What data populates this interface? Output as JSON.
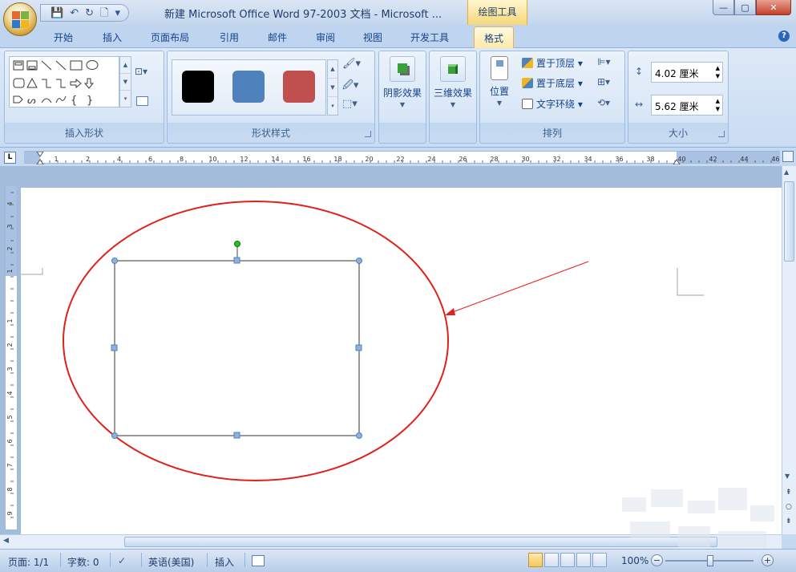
{
  "titlebar": {
    "title": "新建 Microsoft Office Word 97-2003 文档 - Microsoft ...",
    "context_tab": "绘图工具",
    "qat_save": "💾",
    "qat_undo": "↶",
    "qat_redo": "↻",
    "qat_preview": "🗋",
    "qat_more": "▾",
    "minimize": "—",
    "maximize": "▢",
    "close": "✕"
  },
  "tabs": [
    "开始",
    "插入",
    "页面布局",
    "引用",
    "邮件",
    "审阅",
    "视图",
    "开发工具",
    "格式"
  ],
  "active_tab": "格式",
  "ribbon": {
    "insert_shapes": {
      "label": "插入形状",
      "edit_shape": "⊡▾"
    },
    "shape_styles": {
      "label": "形状样式",
      "swatches": [
        "#000000",
        "#4f81bd",
        "#c0504d"
      ],
      "fill": "🖌▾",
      "outline": "🖉▾",
      "change": "⬚▾"
    },
    "shadow": {
      "label": "阴影效果"
    },
    "three_d": {
      "label": "三维效果"
    },
    "arrange": {
      "label": "排列",
      "position": "位置",
      "bring_front": "置于顶层 ▾",
      "send_back": "置于底层 ▾",
      "text_wrap": "文字环绕 ▾",
      "align": "⊫▾",
      "group": "⊞▾",
      "rotate": "⟲▾"
    },
    "size": {
      "label": "大小",
      "height": "4.02 厘米",
      "width": "5.62 厘米"
    }
  },
  "ruler": {
    "corner": "L",
    "h_labels": [
      "1",
      "2",
      "4",
      "6",
      "8",
      "10",
      "12",
      "14",
      "16",
      "18",
      "20",
      "22",
      "24",
      "26",
      "28",
      "30",
      "32",
      "34",
      "36",
      "38",
      "40",
      "42",
      "44",
      "46"
    ],
    "v_labels": [
      "4",
      "3",
      "2",
      "1",
      "1",
      "2",
      "3",
      "4",
      "5",
      "6",
      "7",
      "8",
      "9"
    ]
  },
  "statusbar": {
    "page": "页面: 1/1",
    "words": "字数: 0",
    "language": "英语(美国)",
    "mode": "插入",
    "zoom": "100%",
    "zoom_out": "−",
    "zoom_in": "+"
  },
  "colors": {
    "accent": "#15428b",
    "ribbon_bg": "#dde9f7",
    "annotation_red": "#e0201a",
    "handle_blue": "#4f81bd",
    "rotate_green": "#22c422"
  }
}
